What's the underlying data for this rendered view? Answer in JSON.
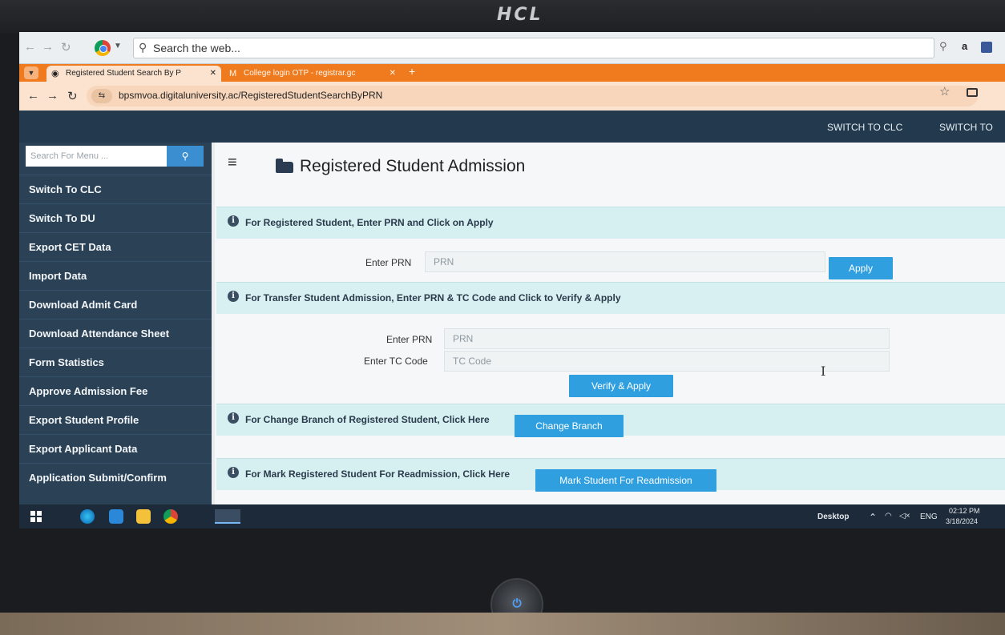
{
  "monitor": {
    "brand": "HCL"
  },
  "outer_browser": {
    "search_placeholder": "Search the web...",
    "right_icons": [
      "a"
    ]
  },
  "tabs": [
    {
      "label": "Registered Student Search By P",
      "active": true
    },
    {
      "label": "College login OTP - registrar.gc",
      "active": false
    }
  ],
  "address": {
    "url": "bpsmvoa.digitaluniversity.ac/RegisteredStudentSearchByPRN"
  },
  "header": {
    "links": [
      "SWITCH TO CLC",
      "SWITCH TO"
    ]
  },
  "sidebar": {
    "search_placeholder": "Search For Menu ...",
    "items": [
      "Switch To CLC",
      "Switch To DU",
      "Export CET Data",
      "Import Data",
      "Download Admit Card",
      "Download Attendance Sheet",
      "Form Statistics",
      "Approve Admission Fee",
      "Export Student Profile",
      "Export Applicant Data",
      "Application Submit/Confirm"
    ]
  },
  "page": {
    "title": "Registered Student Admission",
    "registered": {
      "note": "For Registered Student, Enter PRN and Click on Apply",
      "prn_label": "Enter PRN",
      "prn_placeholder": "PRN",
      "apply_label": "Apply"
    },
    "transfer": {
      "note": "For Transfer Student Admission, Enter PRN & TC Code and Click to Verify & Apply",
      "prn_label": "Enter PRN",
      "prn_placeholder": "PRN",
      "tc_label": "Enter TC Code",
      "tc_placeholder": "TC Code",
      "verify_label": "Verify & Apply"
    },
    "change_branch": {
      "note": "For Change Branch of Registered Student, Click Here",
      "button_label": "Change Branch"
    },
    "readmission": {
      "note": "For Mark Registered Student For Readmission, Click Here",
      "button_label": "Mark Student For Readmission"
    }
  },
  "taskbar": {
    "desktop_label": "Desktop",
    "language": "ENG",
    "time": "02:12 PM",
    "date": "3/18/2024"
  },
  "colors": {
    "header_bg": "#233a4e",
    "sidebar_bg": "#2b4156",
    "button_blue": "#2f9fe0",
    "info_band": "#d6eff1",
    "tab_strip": "#f07a1e"
  }
}
